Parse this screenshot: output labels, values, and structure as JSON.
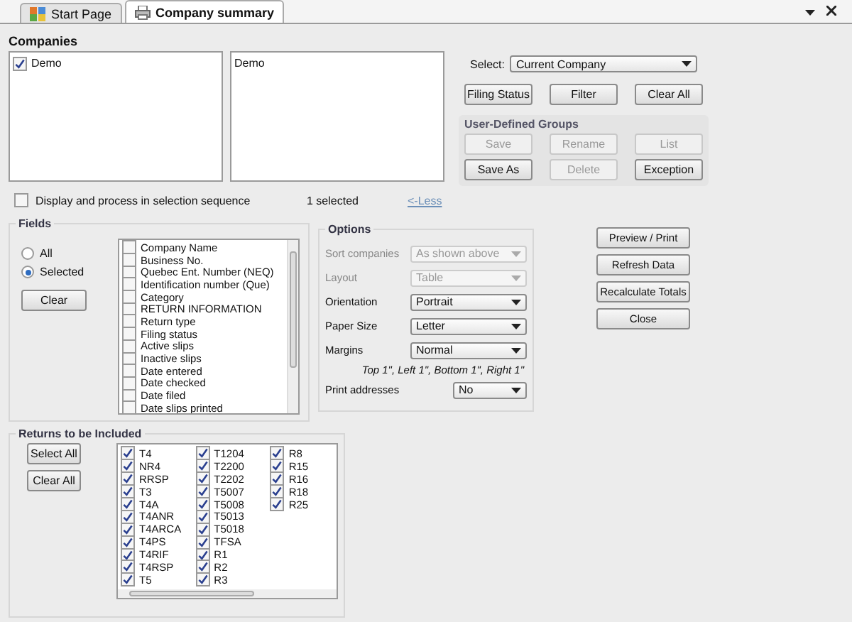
{
  "tabs": [
    {
      "label": "Start Page",
      "selected": false
    },
    {
      "label": "Company summary",
      "selected": true
    }
  ],
  "companies": {
    "title": "Companies",
    "available": [
      {
        "label": "Demo",
        "checked": true
      }
    ],
    "chosen": [
      "Demo"
    ],
    "select_label": "Select:",
    "select_value": "Current Company",
    "buttons": [
      "Filing Status",
      "Filter",
      "Clear All"
    ]
  },
  "groups": {
    "title": "User-Defined Groups",
    "buttons": [
      {
        "label": "Save",
        "disabled": true
      },
      {
        "label": "Rename",
        "disabled": true
      },
      {
        "label": "List",
        "disabled": true
      },
      {
        "label": "Save As",
        "disabled": false
      },
      {
        "label": "Delete",
        "disabled": true
      },
      {
        "label": "Exception",
        "disabled": false
      }
    ]
  },
  "sequence": {
    "label": "Display and process in selection sequence",
    "checked": false
  },
  "selected_count": "1 selected",
  "less_link": "<-Less",
  "fields": {
    "title": "Fields",
    "modes": [
      {
        "label": "All",
        "selected": false
      },
      {
        "label": "Selected",
        "selected": true
      }
    ],
    "clear": "Clear",
    "items": [
      {
        "label": "Company Name",
        "checked": false
      },
      {
        "label": "Business No.",
        "checked": false
      },
      {
        "label": "Quebec Ent. Number (NEQ)",
        "checked": false
      },
      {
        "label": "Identification number (Que)",
        "checked": false
      },
      {
        "label": "Category",
        "checked": false
      },
      {
        "label": "RETURN INFORMATION",
        "checked": false
      },
      {
        "label": "Return type",
        "checked": false
      },
      {
        "label": "Filing status",
        "checked": false
      },
      {
        "label": "Active slips",
        "checked": false
      },
      {
        "label": "Inactive slips",
        "checked": false
      },
      {
        "label": "Date entered",
        "checked": false
      },
      {
        "label": "Date checked",
        "checked": false
      },
      {
        "label": "Date filed",
        "checked": false
      },
      {
        "label": "Date slips printed",
        "checked": false
      }
    ]
  },
  "options": {
    "title": "Options",
    "rows": [
      {
        "label": "Sort companies",
        "value": "As shown above",
        "disabled": true
      },
      {
        "label": "Layout",
        "value": "Table",
        "disabled": true
      },
      {
        "label": "Orientation",
        "value": "Portrait",
        "disabled": false
      },
      {
        "label": "Paper Size",
        "value": "Letter",
        "disabled": false
      },
      {
        "label": "Margins",
        "value": "Normal",
        "disabled": false
      }
    ],
    "margin_note": "Top 1\", Left 1\", Bottom 1\", Right 1\"",
    "print_addresses": {
      "label": "Print addresses",
      "value": "No"
    }
  },
  "actions": [
    "Preview / Print",
    "Refresh Data",
    "Recalculate Totals",
    "Close"
  ],
  "returns": {
    "title": "Returns to be Included",
    "buttons": [
      "Select All",
      "Clear All"
    ],
    "columns": [
      [
        {
          "label": "T4",
          "checked": true
        },
        {
          "label": "NR4",
          "checked": true
        },
        {
          "label": "RRSP",
          "checked": true
        },
        {
          "label": "T3",
          "checked": true
        },
        {
          "label": "T4A",
          "checked": true
        },
        {
          "label": "T4ANR",
          "checked": true
        },
        {
          "label": "T4ARCA",
          "checked": true
        },
        {
          "label": "T4PS",
          "checked": true
        },
        {
          "label": "T4RIF",
          "checked": true
        },
        {
          "label": "T4RSP",
          "checked": true
        },
        {
          "label": "T5",
          "checked": true
        }
      ],
      [
        {
          "label": "T1204",
          "checked": true
        },
        {
          "label": "T2200",
          "checked": true
        },
        {
          "label": "T2202",
          "checked": true
        },
        {
          "label": "T5007",
          "checked": true
        },
        {
          "label": "T5008",
          "checked": true
        },
        {
          "label": "T5013",
          "checked": true
        },
        {
          "label": "T5018",
          "checked": true
        },
        {
          "label": "TFSA",
          "checked": true
        },
        {
          "label": "R1",
          "checked": true
        },
        {
          "label": "R2",
          "checked": true
        },
        {
          "label": "R3",
          "checked": true
        }
      ],
      [
        {
          "label": "R8",
          "checked": true
        },
        {
          "label": "R15",
          "checked": true
        },
        {
          "label": "R16",
          "checked": true
        },
        {
          "label": "R18",
          "checked": true
        },
        {
          "label": "R25",
          "checked": true
        }
      ]
    ]
  }
}
